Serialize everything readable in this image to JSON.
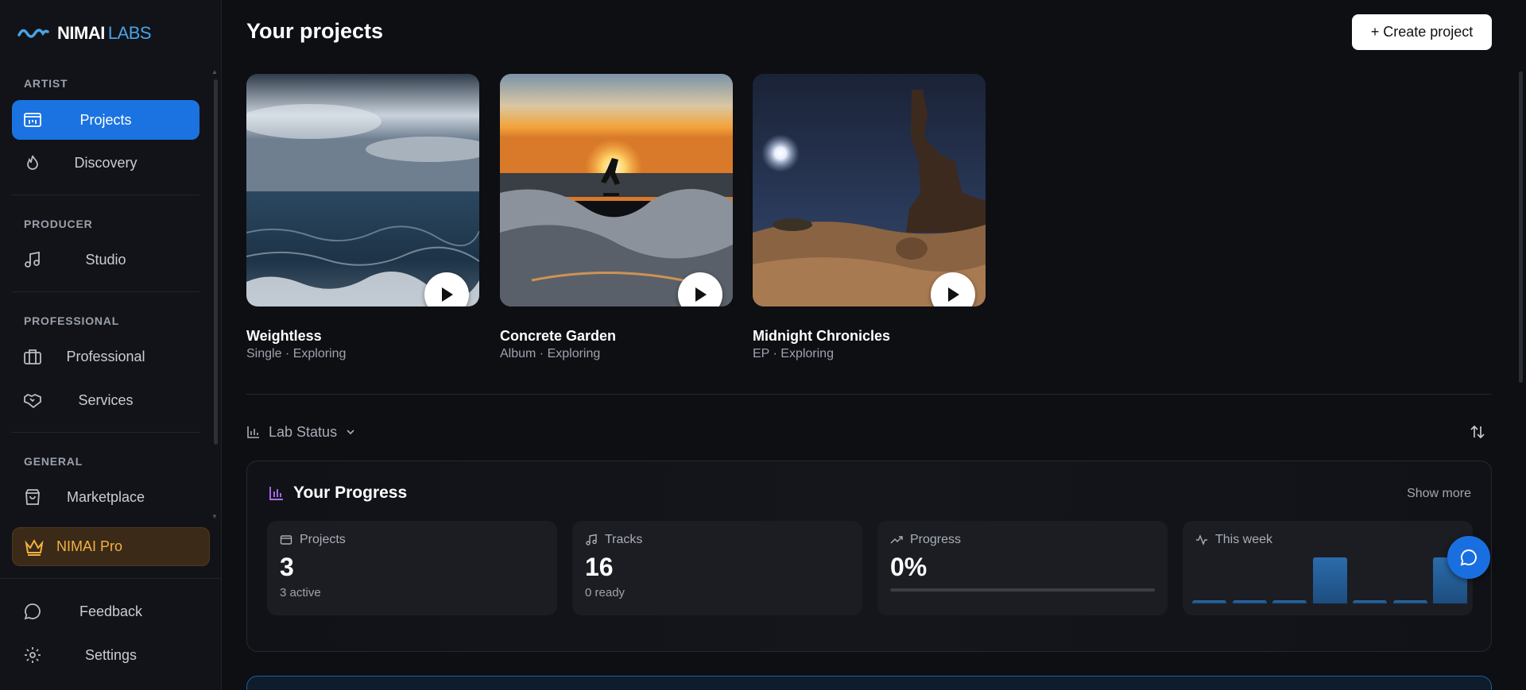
{
  "brand": {
    "name": "NIMAI",
    "suffix": "LABS"
  },
  "sidebar": {
    "sections": [
      {
        "label": "ARTIST"
      },
      {
        "label": "PRODUCER"
      },
      {
        "label": "PROFESSIONAL"
      },
      {
        "label": "GENERAL"
      }
    ],
    "items": [
      {
        "label": "Projects",
        "icon": "projects-icon",
        "active": true
      },
      {
        "label": "Discovery",
        "icon": "flame-icon"
      },
      {
        "label": "Studio",
        "icon": "music-note-icon"
      },
      {
        "label": "Professional",
        "icon": "briefcase-icon"
      },
      {
        "label": "Services",
        "icon": "handshake-icon"
      },
      {
        "label": "Marketplace",
        "icon": "shopping-bag-icon"
      }
    ],
    "pro": {
      "label": "NIMAI Pro",
      "icon": "crown-icon",
      "color": "#f4b042"
    },
    "footer": [
      {
        "label": "Feedback",
        "icon": "chat-bubble-icon"
      },
      {
        "label": "Settings",
        "icon": "gear-icon"
      }
    ]
  },
  "header": {
    "title": "Your projects",
    "create_label": "+ Create project"
  },
  "projects": [
    {
      "title": "Weightless",
      "subtitle": "Single · Exploring"
    },
    {
      "title": "Concrete Garden",
      "subtitle": "Album · Exploring"
    },
    {
      "title": "Midnight Chronicles",
      "subtitle": "EP · Exploring"
    }
  ],
  "lab_status": {
    "label": "Lab Status"
  },
  "progress_panel": {
    "title": "Your Progress",
    "show_more": "Show more",
    "stats": {
      "projects": {
        "label": "Projects",
        "value": "3",
        "note": "3 active"
      },
      "tracks": {
        "label": "Tracks",
        "value": "16",
        "note": "0 ready"
      },
      "progress": {
        "label": "Progress",
        "value": "0%",
        "fraction": 0
      },
      "week": {
        "label": "This week",
        "levels": [
          0.06,
          0.06,
          0.06,
          0.94,
          0.06,
          0.06,
          0.94
        ]
      }
    }
  },
  "colors": {
    "accent": "#1a73e0",
    "pro": "#f4b042",
    "brand_labs": "#4aa3e6"
  }
}
